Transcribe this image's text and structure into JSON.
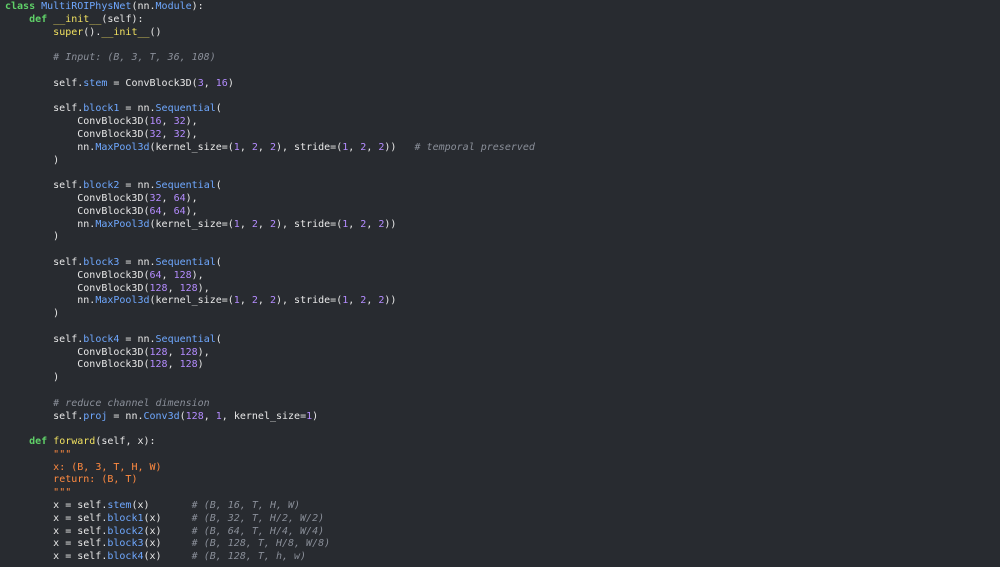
{
  "colors": {
    "background": "#282b30",
    "keyword": "#5fd068",
    "class_name": "#6fa8ff",
    "function_name": "#f0e060",
    "attribute": "#6fa8ff",
    "number": "#b48cff",
    "comment": "#8a8f99",
    "docstring": "#ff8a40",
    "text": "#e8e8e8"
  },
  "lines": [
    [
      [
        "kw",
        "class "
      ],
      [
        "cls",
        "MultiROIPhysNet"
      ],
      [
        "plain",
        "(nn."
      ],
      [
        "cls",
        "Module"
      ],
      [
        "plain",
        "):"
      ]
    ],
    [
      [
        "plain",
        "    "
      ],
      [
        "kw",
        "def "
      ],
      [
        "fn",
        "__init__"
      ],
      [
        "plain",
        "(self):"
      ]
    ],
    [
      [
        "plain",
        "        "
      ],
      [
        "fn",
        "super"
      ],
      [
        "plain",
        "()."
      ],
      [
        "fn",
        "__init__"
      ],
      [
        "plain",
        "()"
      ]
    ],
    [
      [
        "plain",
        ""
      ]
    ],
    [
      [
        "plain",
        "        "
      ],
      [
        "cmt",
        "# Input: (B, 3, T, 36, 108)"
      ]
    ],
    [
      [
        "plain",
        ""
      ]
    ],
    [
      [
        "plain",
        "        self."
      ],
      [
        "attr",
        "stem"
      ],
      [
        "plain",
        " = ConvBlock3D("
      ],
      [
        "num",
        "3"
      ],
      [
        "plain",
        ", "
      ],
      [
        "num",
        "16"
      ],
      [
        "plain",
        ")"
      ]
    ],
    [
      [
        "plain",
        ""
      ]
    ],
    [
      [
        "plain",
        "        self."
      ],
      [
        "attr",
        "block1"
      ],
      [
        "plain",
        " = nn."
      ],
      [
        "attr",
        "Sequential"
      ],
      [
        "plain",
        "("
      ]
    ],
    [
      [
        "plain",
        "            ConvBlock3D("
      ],
      [
        "num",
        "16"
      ],
      [
        "plain",
        ", "
      ],
      [
        "num",
        "32"
      ],
      [
        "plain",
        "),"
      ]
    ],
    [
      [
        "plain",
        "            ConvBlock3D("
      ],
      [
        "num",
        "32"
      ],
      [
        "plain",
        ", "
      ],
      [
        "num",
        "32"
      ],
      [
        "plain",
        "),"
      ]
    ],
    [
      [
        "plain",
        "            nn."
      ],
      [
        "attr",
        "MaxPool3d"
      ],
      [
        "plain",
        "(kernel_size=("
      ],
      [
        "num",
        "1"
      ],
      [
        "plain",
        ", "
      ],
      [
        "num",
        "2"
      ],
      [
        "plain",
        ", "
      ],
      [
        "num",
        "2"
      ],
      [
        "plain",
        "), stride=("
      ],
      [
        "num",
        "1"
      ],
      [
        "plain",
        ", "
      ],
      [
        "num",
        "2"
      ],
      [
        "plain",
        ", "
      ],
      [
        "num",
        "2"
      ],
      [
        "plain",
        "))   "
      ],
      [
        "cmt",
        "# temporal preserved"
      ]
    ],
    [
      [
        "plain",
        "        )"
      ]
    ],
    [
      [
        "plain",
        ""
      ]
    ],
    [
      [
        "plain",
        "        self."
      ],
      [
        "attr",
        "block2"
      ],
      [
        "plain",
        " = nn."
      ],
      [
        "attr",
        "Sequential"
      ],
      [
        "plain",
        "("
      ]
    ],
    [
      [
        "plain",
        "            ConvBlock3D("
      ],
      [
        "num",
        "32"
      ],
      [
        "plain",
        ", "
      ],
      [
        "num",
        "64"
      ],
      [
        "plain",
        "),"
      ]
    ],
    [
      [
        "plain",
        "            ConvBlock3D("
      ],
      [
        "num",
        "64"
      ],
      [
        "plain",
        ", "
      ],
      [
        "num",
        "64"
      ],
      [
        "plain",
        "),"
      ]
    ],
    [
      [
        "plain",
        "            nn."
      ],
      [
        "attr",
        "MaxPool3d"
      ],
      [
        "plain",
        "(kernel_size=("
      ],
      [
        "num",
        "1"
      ],
      [
        "plain",
        ", "
      ],
      [
        "num",
        "2"
      ],
      [
        "plain",
        ", "
      ],
      [
        "num",
        "2"
      ],
      [
        "plain",
        "), stride=("
      ],
      [
        "num",
        "1"
      ],
      [
        "plain",
        ", "
      ],
      [
        "num",
        "2"
      ],
      [
        "plain",
        ", "
      ],
      [
        "num",
        "2"
      ],
      [
        "plain",
        "))"
      ]
    ],
    [
      [
        "plain",
        "        )"
      ]
    ],
    [
      [
        "plain",
        ""
      ]
    ],
    [
      [
        "plain",
        "        self."
      ],
      [
        "attr",
        "block3"
      ],
      [
        "plain",
        " = nn."
      ],
      [
        "attr",
        "Sequential"
      ],
      [
        "plain",
        "("
      ]
    ],
    [
      [
        "plain",
        "            ConvBlock3D("
      ],
      [
        "num",
        "64"
      ],
      [
        "plain",
        ", "
      ],
      [
        "num",
        "128"
      ],
      [
        "plain",
        "),"
      ]
    ],
    [
      [
        "plain",
        "            ConvBlock3D("
      ],
      [
        "num",
        "128"
      ],
      [
        "plain",
        ", "
      ],
      [
        "num",
        "128"
      ],
      [
        "plain",
        "),"
      ]
    ],
    [
      [
        "plain",
        "            nn."
      ],
      [
        "attr",
        "MaxPool3d"
      ],
      [
        "plain",
        "(kernel_size=("
      ],
      [
        "num",
        "1"
      ],
      [
        "plain",
        ", "
      ],
      [
        "num",
        "2"
      ],
      [
        "plain",
        ", "
      ],
      [
        "num",
        "2"
      ],
      [
        "plain",
        "), stride=("
      ],
      [
        "num",
        "1"
      ],
      [
        "plain",
        ", "
      ],
      [
        "num",
        "2"
      ],
      [
        "plain",
        ", "
      ],
      [
        "num",
        "2"
      ],
      [
        "plain",
        "))"
      ]
    ],
    [
      [
        "plain",
        "        )"
      ]
    ],
    [
      [
        "plain",
        ""
      ]
    ],
    [
      [
        "plain",
        "        self."
      ],
      [
        "attr",
        "block4"
      ],
      [
        "plain",
        " = nn."
      ],
      [
        "attr",
        "Sequential"
      ],
      [
        "plain",
        "("
      ]
    ],
    [
      [
        "plain",
        "            ConvBlock3D("
      ],
      [
        "num",
        "128"
      ],
      [
        "plain",
        ", "
      ],
      [
        "num",
        "128"
      ],
      [
        "plain",
        "),"
      ]
    ],
    [
      [
        "plain",
        "            ConvBlock3D("
      ],
      [
        "num",
        "128"
      ],
      [
        "plain",
        ", "
      ],
      [
        "num",
        "128"
      ],
      [
        "plain",
        ")"
      ]
    ],
    [
      [
        "plain",
        "        )"
      ]
    ],
    [
      [
        "plain",
        ""
      ]
    ],
    [
      [
        "plain",
        "        "
      ],
      [
        "cmt",
        "# reduce channel dimension"
      ]
    ],
    [
      [
        "plain",
        "        self."
      ],
      [
        "attr",
        "proj"
      ],
      [
        "plain",
        " = nn."
      ],
      [
        "attr",
        "Conv3d"
      ],
      [
        "plain",
        "("
      ],
      [
        "num",
        "128"
      ],
      [
        "plain",
        ", "
      ],
      [
        "num",
        "1"
      ],
      [
        "plain",
        ", kernel_size="
      ],
      [
        "num",
        "1"
      ],
      [
        "plain",
        ")"
      ]
    ],
    [
      [
        "plain",
        ""
      ]
    ],
    [
      [
        "plain",
        "    "
      ],
      [
        "kw",
        "def "
      ],
      [
        "fn",
        "forward"
      ],
      [
        "plain",
        "(self, x):"
      ]
    ],
    [
      [
        "plain",
        "        "
      ],
      [
        "str",
        "\"\"\""
      ]
    ],
    [
      [
        "plain",
        "        "
      ],
      [
        "str",
        "x: (B, 3, T, H, W)"
      ]
    ],
    [
      [
        "plain",
        "        "
      ],
      [
        "str",
        "return: (B, T)"
      ]
    ],
    [
      [
        "plain",
        "        "
      ],
      [
        "str",
        "\"\"\""
      ]
    ],
    [
      [
        "plain",
        "        x = self."
      ],
      [
        "attr",
        "stem"
      ],
      [
        "plain",
        "(x)       "
      ],
      [
        "cmt",
        "# (B, 16, T, H, W)"
      ]
    ],
    [
      [
        "plain",
        "        x = self."
      ],
      [
        "attr",
        "block1"
      ],
      [
        "plain",
        "(x)     "
      ],
      [
        "cmt",
        "# (B, 32, T, H/2, W/2)"
      ]
    ],
    [
      [
        "plain",
        "        x = self."
      ],
      [
        "attr",
        "block2"
      ],
      [
        "plain",
        "(x)     "
      ],
      [
        "cmt",
        "# (B, 64, T, H/4, W/4)"
      ]
    ],
    [
      [
        "plain",
        "        x = self."
      ],
      [
        "attr",
        "block3"
      ],
      [
        "plain",
        "(x)     "
      ],
      [
        "cmt",
        "# (B, 128, T, H/8, W/8)"
      ]
    ],
    [
      [
        "plain",
        "        x = self."
      ],
      [
        "attr",
        "block4"
      ],
      [
        "plain",
        "(x)     "
      ],
      [
        "cmt",
        "# (B, 128, T, h, w)"
      ]
    ]
  ]
}
